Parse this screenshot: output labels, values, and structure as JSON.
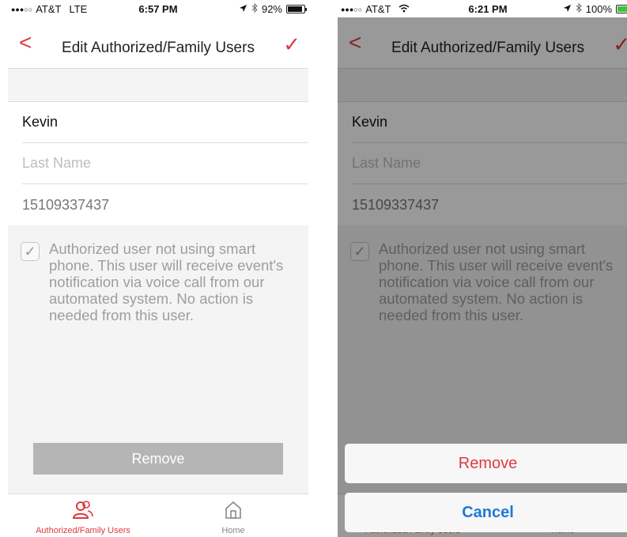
{
  "screens": [
    {
      "status": {
        "dots": "●●●○○",
        "carrier": "AT&T",
        "network": "LTE",
        "time": "6:57 PM",
        "location_icon": "location-arrow-icon",
        "bluetooth_icon": "bluetooth-icon",
        "battery": "92%",
        "battery_level": 0.92,
        "battery_color": "#111111"
      },
      "nav": {
        "back": "<",
        "title": "Edit Authorized/Family Users",
        "save": "✓"
      },
      "form": {
        "first_name": "Kevin",
        "last_name_placeholder": "Last Name",
        "phone": "15109337437"
      },
      "checkbox": {
        "checked": true,
        "text": "Authorized user not using smart phone. This user will receive event's notification via voice call from our automated system. No action is needed from this user."
      },
      "remove_label": "Remove",
      "tabs": [
        {
          "label": "Authorized/Family Users",
          "icon": "users-icon",
          "active": true
        },
        {
          "label": "Home",
          "icon": "home-icon",
          "active": false
        }
      ]
    },
    {
      "status": {
        "dots": "●●●○○",
        "carrier": "AT&T",
        "network": "wifi",
        "time": "6:21 PM",
        "location_icon": "location-arrow-icon",
        "bluetooth_icon": "bluetooth-icon",
        "battery": "100%",
        "battery_level": 1.0,
        "battery_color": "#3bc43b"
      },
      "nav": {
        "back": "<",
        "title": "Edit Authorized/Family Users",
        "save": "✓"
      },
      "form": {
        "first_name": "Kevin",
        "last_name_placeholder": "Last Name",
        "phone": "15109337437"
      },
      "checkbox": {
        "checked": true,
        "text": "Authorized user not using smart phone. This user will receive event's notification via voice call from our automated system. No action is needed from this user."
      },
      "tabs": [
        {
          "label": "Authorized/Family Users",
          "icon": "users-icon",
          "active": true
        },
        {
          "label": "Home",
          "icon": "home-icon",
          "active": false
        }
      ],
      "action_sheet": {
        "remove_label": "Remove",
        "cancel_label": "Cancel"
      }
    }
  ],
  "colors": {
    "accent": "#e0393e",
    "cancel_blue": "#1e7ad6",
    "disabled_button": "#b5b5b5"
  }
}
